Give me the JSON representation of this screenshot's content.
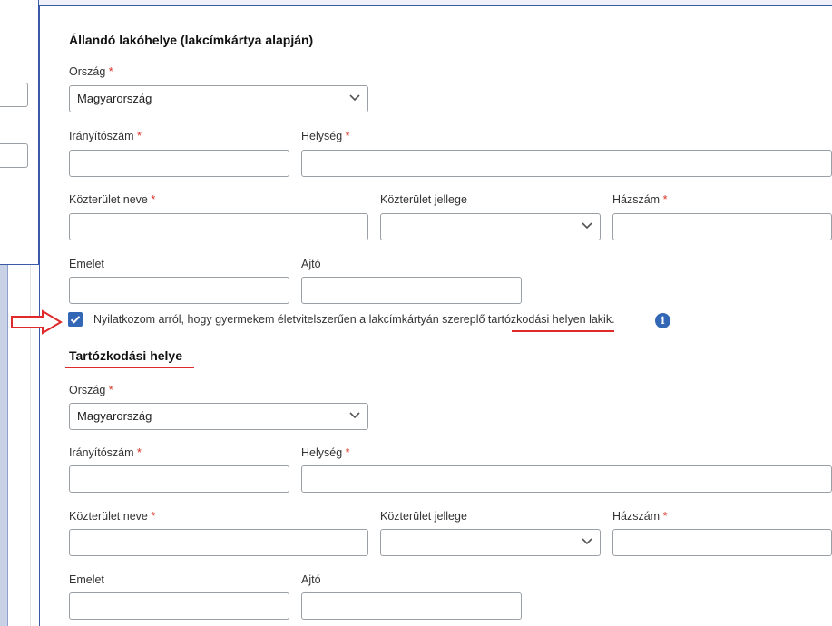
{
  "permanent_address": {
    "section_title": "Állandó lakóhelye (lakcímkártya alapján)",
    "country_label": "Ország",
    "country_value": "Magyarország",
    "zip_label": "Irányítószám",
    "city_label": "Helység",
    "street_label": "Közterület neve",
    "street_type_label": "Közterület jellege",
    "house_number_label": "Házszám",
    "floor_label": "Emelet",
    "door_label": "Ajtó"
  },
  "declaration": {
    "text_before": "Nyilatkozom arról, hogy gyermekem életvitelszerűen a lakcímkártyán szereplő ",
    "highlight": "tartózkodási helyen",
    "text_after": " lakik.",
    "checked": true,
    "info_icon": "i"
  },
  "residence_address": {
    "section_title": "Tartózkodási helye",
    "country_label": "Ország",
    "country_value": "Magyarország",
    "zip_label": "Irányítószám",
    "city_label": "Helység",
    "street_label": "Közterület neve",
    "street_type_label": "Közterület jellege",
    "house_number_label": "Házszám",
    "floor_label": "Emelet",
    "door_label": "Ajtó"
  },
  "required_mark": "*",
  "colors": {
    "accent": "#3267b5",
    "required": "#d93025",
    "annotation": "#e0292a",
    "frame": "#3a5aa8"
  },
  "icons": {
    "dropdown": "chevron-down-icon",
    "checkbox": "checkmark-icon",
    "info": "info-icon",
    "annotation": "arrow-right-icon"
  }
}
